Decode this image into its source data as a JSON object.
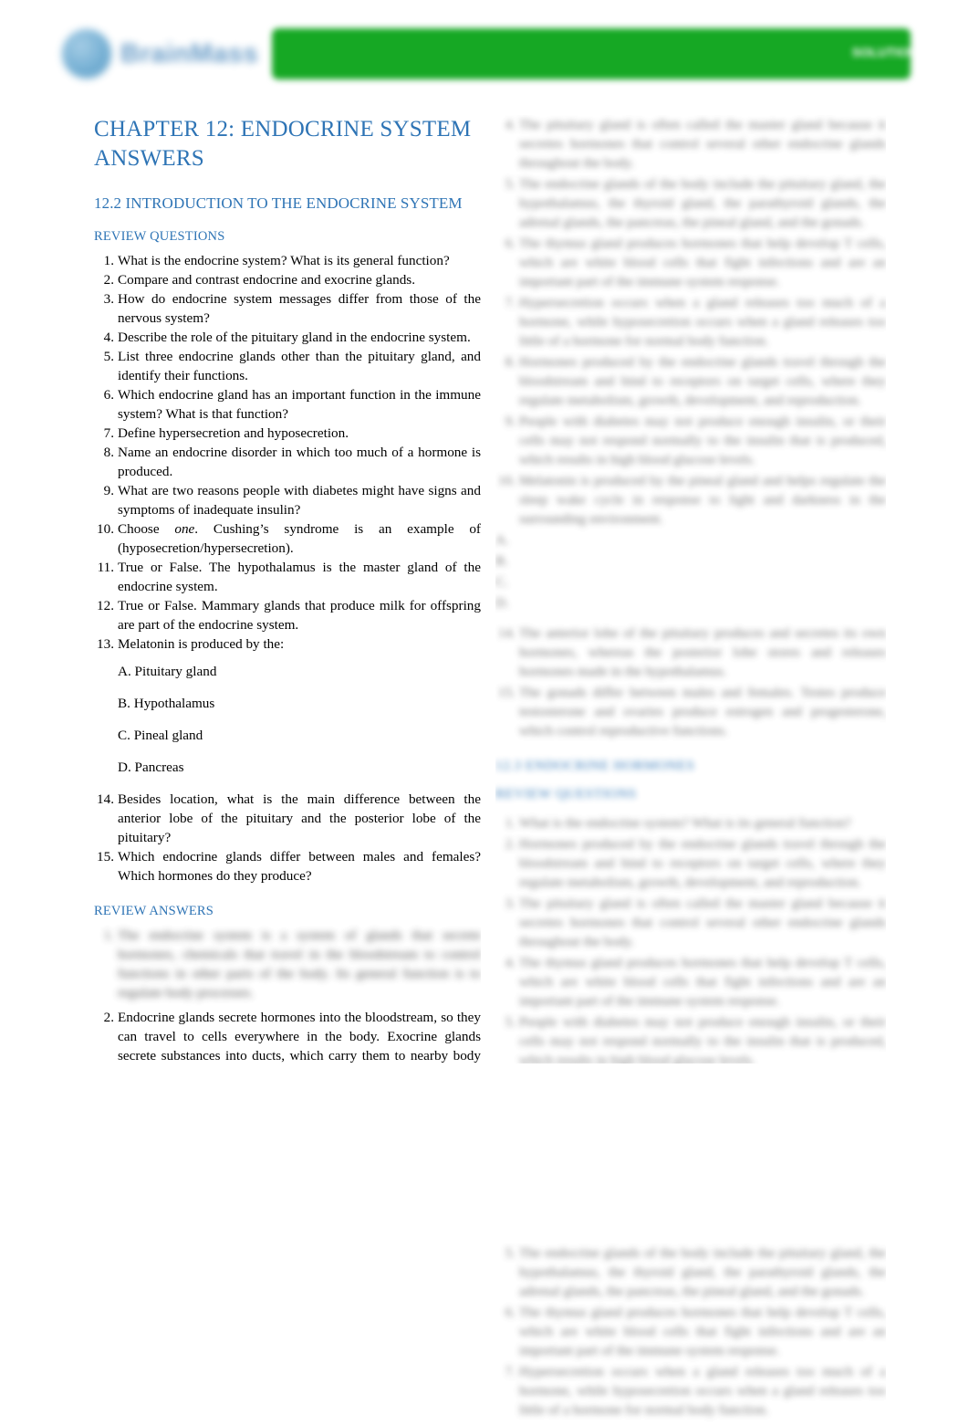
{
  "header": {
    "brand_name": "BrainMass",
    "banner_label": "SOLUTION",
    "banner_icon": "document-icon",
    "brand_icon": "circular-logo-icon",
    "green_color": "#16a824",
    "brand_color": "#5b93c2"
  },
  "document": {
    "title": "CHAPTER 12: ENDOCRINE SYSTEM ANSWERS",
    "section_title": "12.2 INTRODUCTION TO THE ENDOCRINE SYSTEM",
    "heading_color": "#2e74b5",
    "review_questions_label": "REVIEW QUESTIONS",
    "review_answers_label": "REVIEW ANSWERS"
  },
  "questions": [
    "What is the endocrine system? What is its general function?",
    "Compare and contrast endocrine and exocrine glands.",
    "How do endocrine system messages differ from those of the nervous system?",
    "Describe the role of the pituitary gland in the endocrine system.",
    "List three endocrine glands other than the pituitary gland, and identify their functions.",
    "Which endocrine gland has an important function in the immune system? What is that function?",
    "Define hypersecretion and hyposecretion.",
    "Name an endocrine disorder in which too much of a hormone is produced.",
    "What are two reasons people with diabetes might have signs and symptoms of inadequate insulin?",
    "Choose one. Cushing’s syndrome is an example of (hyposecretion/hypersecretion).",
    "True or False. The hypothalamus is the master gland of the endocrine system.",
    "True or False. Mammary glands that produce milk for offspring are part of the endocrine system.",
    "Melatonin is produced by the:",
    "Besides location, what is the main difference between the anterior lobe of the pituitary and the posterior lobe of the pituitary?",
    "Which endocrine glands differ between males and females? Which hormones do they produce?"
  ],
  "q10_parts": {
    "lead": "Choose ",
    "italic": "one",
    "tail": ". Cushing’s syndrome is an example of (hyposecretion/hypersecretion)."
  },
  "q13_choices": [
    "A. Pituitary gland",
    "B. Hypothalamus",
    "C. Pineal gland",
    "D. Pancreas"
  ],
  "answers": [
    {
      "number": "1.",
      "visible": false,
      "text": "The endocrine system is a system of glands that secrete hormones, chemicals that travel in the bloodstream to control functions in other parts of the body. Its general function is to regulate body processes."
    },
    {
      "number": "2.",
      "visible": true,
      "text": "Endocrine glands secrete hormones into the bloodstream, so they can travel to cells everywhere in the body. Exocrine glands secrete substances into ducts, which carry them to nearby body surfaces."
    }
  ],
  "right_column": {
    "note": "Content in the right column is blurred and unreadable in the source image.",
    "blurred_headings": [
      "12.3 ENDOCRINE HORMONES",
      "REVIEW QUESTIONS"
    ],
    "blurred_paragraphs": [
      "The endocrine glands of the body include the pituitary gland, the hypothalamus, the thyroid gland, the parathyroid glands, the adrenal glands, the pancreas, the pineal gland, and the gonads.",
      "Hormones produced by the endocrine glands travel through the bloodstream and bind to receptors on target cells, where they regulate metabolism, growth, development, and reproduction.",
      "The pituitary gland is often called the master gland because it secretes hormones that control several other endocrine glands throughout the body.",
      "The thymus gland produces hormones that help develop T cells, which are white blood cells that fight infections and are an important part of the immune system response.",
      "Hypersecretion occurs when a gland releases too much of a hormone, while hyposecretion occurs when a gland releases too little of a hormone for normal body function.",
      "People with diabetes may not produce enough insulin, or their cells may not respond normally to the insulin that is produced, which results in high blood glucose levels.",
      "Melatonin is produced by the pineal gland and helps regulate the sleep wake cycle in response to light and darkness in the surrounding environment.",
      "The anterior lobe of the pituitary produces and secretes its own hormones, whereas the posterior lobe stores and releases hormones made in the hypothalamus.",
      "The gonads differ between males and females. Testes produce testosterone and ovaries produce estrogen and progesterone, which control reproductive functions."
    ],
    "blurred_choices": [
      "A.",
      "B.",
      "C.",
      "D."
    ]
  }
}
